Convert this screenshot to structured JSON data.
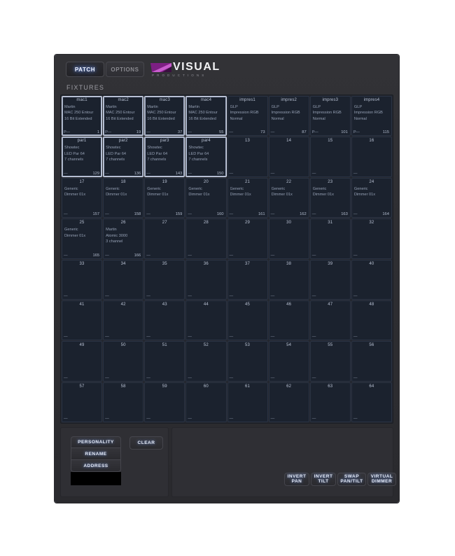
{
  "app": {
    "brand_word": "VISUAL",
    "brand_sub": "PRODUCTIONS",
    "accent_purple": "#a431a8",
    "accent_glow": "#7ea6ff",
    "panel_bg": "#2e2e32",
    "grid_bg": "#23262e",
    "cell_bg": "#1b222e"
  },
  "tabs": [
    {
      "id": "patch",
      "label": "PATCH",
      "active": true
    },
    {
      "id": "options",
      "label": "OPTIONS",
      "active": false
    }
  ],
  "section": {
    "fixtures_label": "FIXTURES"
  },
  "grid": {
    "columns": 8,
    "rows": 8,
    "total": 64,
    "cells": [
      {
        "index": 1,
        "name": "mac1",
        "manufacturer": "Martin",
        "model": "MAC 250 Entour",
        "mode": "16 Bit Extended",
        "prefix": "P—",
        "address": "1",
        "selected": true
      },
      {
        "index": 2,
        "name": "mac2",
        "manufacturer": "Martin",
        "model": "MAC 250 Entour",
        "mode": "16 Bit Extended",
        "prefix": "P—",
        "address": "19",
        "selected": true
      },
      {
        "index": 3,
        "name": "mac3",
        "manufacturer": "Martin",
        "model": "MAC 250 Entour",
        "mode": "16 Bit Extended",
        "prefix": "—",
        "address": "37",
        "selected": true
      },
      {
        "index": 4,
        "name": "mac4",
        "manufacturer": "Martin",
        "model": "MAC 250 Entour",
        "mode": "16 Bit Extended",
        "prefix": "—",
        "address": "55",
        "selected": true
      },
      {
        "index": 5,
        "name": "impres1",
        "manufacturer": "GLP",
        "model": "Impression RGB",
        "mode": "Normal",
        "prefix": "—",
        "address": "73",
        "selected": false
      },
      {
        "index": 6,
        "name": "impres2",
        "manufacturer": "GLP",
        "model": "Impression RGB",
        "mode": "Normal",
        "prefix": "—",
        "address": "87",
        "selected": false
      },
      {
        "index": 7,
        "name": "impres3",
        "manufacturer": "GLP",
        "model": "Impression RGB",
        "mode": "Normal",
        "prefix": "P—",
        "address": "101",
        "selected": false
      },
      {
        "index": 8,
        "name": "impres4",
        "manufacturer": "GLP",
        "model": "Impression RGB",
        "mode": "Normal",
        "prefix": "P—",
        "address": "115",
        "selected": false
      },
      {
        "index": 9,
        "name": "par1",
        "manufacturer": "Showtec",
        "model": "LED Par 64",
        "mode": "7 channels",
        "prefix": "—",
        "address": "129",
        "selected": true
      },
      {
        "index": 10,
        "name": "par2",
        "manufacturer": "Showtec",
        "model": "LED Par 64",
        "mode": "7 channels",
        "prefix": "—",
        "address": "136",
        "selected": true
      },
      {
        "index": 11,
        "name": "par3",
        "manufacturer": "Showtec",
        "model": "LED Par 64",
        "mode": "7 channels",
        "prefix": "—",
        "address": "143",
        "selected": true
      },
      {
        "index": 12,
        "name": "par4",
        "manufacturer": "Showtec",
        "model": "LED Par 64",
        "mode": "7 channels",
        "prefix": "—",
        "address": "150",
        "selected": true
      },
      {
        "index": 13,
        "name": "13",
        "manufacturer": "",
        "model": "",
        "mode": "",
        "prefix": "—",
        "address": "",
        "selected": false
      },
      {
        "index": 14,
        "name": "14",
        "manufacturer": "",
        "model": "",
        "mode": "",
        "prefix": "—",
        "address": "",
        "selected": false
      },
      {
        "index": 15,
        "name": "15",
        "manufacturer": "",
        "model": "",
        "mode": "",
        "prefix": "—",
        "address": "",
        "selected": false
      },
      {
        "index": 16,
        "name": "16",
        "manufacturer": "",
        "model": "",
        "mode": "",
        "prefix": "—",
        "address": "",
        "selected": false
      },
      {
        "index": 17,
        "name": "17",
        "manufacturer": "Generic",
        "model": "Dimmer 01x",
        "mode": "",
        "prefix": "—",
        "address": "157",
        "selected": false
      },
      {
        "index": 18,
        "name": "18",
        "manufacturer": "Generic",
        "model": "Dimmer 01x",
        "mode": "",
        "prefix": "—",
        "address": "158",
        "selected": false
      },
      {
        "index": 19,
        "name": "19",
        "manufacturer": "Generic",
        "model": "Dimmer 01x",
        "mode": "",
        "prefix": "—",
        "address": "159",
        "selected": false
      },
      {
        "index": 20,
        "name": "20",
        "manufacturer": "Generic",
        "model": "Dimmer 01x",
        "mode": "",
        "prefix": "—",
        "address": "160",
        "selected": false
      },
      {
        "index": 21,
        "name": "21",
        "manufacturer": "Generic",
        "model": "Dimmer 01x",
        "mode": "",
        "prefix": "—",
        "address": "161",
        "selected": false
      },
      {
        "index": 22,
        "name": "22",
        "manufacturer": "Generic",
        "model": "Dimmer 01x",
        "mode": "",
        "prefix": "—",
        "address": "162",
        "selected": false
      },
      {
        "index": 23,
        "name": "23",
        "manufacturer": "Generic",
        "model": "Dimmer 01x",
        "mode": "",
        "prefix": "—",
        "address": "163",
        "selected": false
      },
      {
        "index": 24,
        "name": "24",
        "manufacturer": "Generic",
        "model": "Dimmer 01x",
        "mode": "",
        "prefix": "—",
        "address": "164",
        "selected": false
      },
      {
        "index": 25,
        "name": "25",
        "manufacturer": "Generic",
        "model": "Dimmer 01x",
        "mode": "",
        "prefix": "—",
        "address": "165",
        "selected": false
      },
      {
        "index": 26,
        "name": "26",
        "manufacturer": "Martin",
        "model": "Atomic 3000",
        "mode": "3 channel",
        "prefix": "—",
        "address": "166",
        "selected": false
      },
      {
        "index": 27,
        "name": "27",
        "manufacturer": "",
        "model": "",
        "mode": "",
        "prefix": "—",
        "address": "",
        "selected": false
      },
      {
        "index": 28,
        "name": "28",
        "manufacturer": "",
        "model": "",
        "mode": "",
        "prefix": "—",
        "address": "",
        "selected": false
      },
      {
        "index": 29,
        "name": "29",
        "manufacturer": "",
        "model": "",
        "mode": "",
        "prefix": "—",
        "address": "",
        "selected": false
      },
      {
        "index": 30,
        "name": "30",
        "manufacturer": "",
        "model": "",
        "mode": "",
        "prefix": "—",
        "address": "",
        "selected": false
      },
      {
        "index": 31,
        "name": "31",
        "manufacturer": "",
        "model": "",
        "mode": "",
        "prefix": "—",
        "address": "",
        "selected": false
      },
      {
        "index": 32,
        "name": "32",
        "manufacturer": "",
        "model": "",
        "mode": "",
        "prefix": "—",
        "address": "",
        "selected": false
      },
      {
        "index": 33,
        "name": "33",
        "manufacturer": "",
        "model": "",
        "mode": "",
        "prefix": "—",
        "address": "",
        "selected": false
      },
      {
        "index": 34,
        "name": "34",
        "manufacturer": "",
        "model": "",
        "mode": "",
        "prefix": "—",
        "address": "",
        "selected": false
      },
      {
        "index": 35,
        "name": "35",
        "manufacturer": "",
        "model": "",
        "mode": "",
        "prefix": "—",
        "address": "",
        "selected": false
      },
      {
        "index": 36,
        "name": "36",
        "manufacturer": "",
        "model": "",
        "mode": "",
        "prefix": "—",
        "address": "",
        "selected": false
      },
      {
        "index": 37,
        "name": "37",
        "manufacturer": "",
        "model": "",
        "mode": "",
        "prefix": "—",
        "address": "",
        "selected": false
      },
      {
        "index": 38,
        "name": "38",
        "manufacturer": "",
        "model": "",
        "mode": "",
        "prefix": "—",
        "address": "",
        "selected": false
      },
      {
        "index": 39,
        "name": "39",
        "manufacturer": "",
        "model": "",
        "mode": "",
        "prefix": "—",
        "address": "",
        "selected": false
      },
      {
        "index": 40,
        "name": "40",
        "manufacturer": "",
        "model": "",
        "mode": "",
        "prefix": "—",
        "address": "",
        "selected": false
      },
      {
        "index": 41,
        "name": "41",
        "manufacturer": "",
        "model": "",
        "mode": "",
        "prefix": "—",
        "address": "",
        "selected": false
      },
      {
        "index": 42,
        "name": "42",
        "manufacturer": "",
        "model": "",
        "mode": "",
        "prefix": "—",
        "address": "",
        "selected": false
      },
      {
        "index": 43,
        "name": "43",
        "manufacturer": "",
        "model": "",
        "mode": "",
        "prefix": "—",
        "address": "",
        "selected": false
      },
      {
        "index": 44,
        "name": "44",
        "manufacturer": "",
        "model": "",
        "mode": "",
        "prefix": "—",
        "address": "",
        "selected": false
      },
      {
        "index": 45,
        "name": "45",
        "manufacturer": "",
        "model": "",
        "mode": "",
        "prefix": "—",
        "address": "",
        "selected": false
      },
      {
        "index": 46,
        "name": "46",
        "manufacturer": "",
        "model": "",
        "mode": "",
        "prefix": "—",
        "address": "",
        "selected": false
      },
      {
        "index": 47,
        "name": "47",
        "manufacturer": "",
        "model": "",
        "mode": "",
        "prefix": "—",
        "address": "",
        "selected": false
      },
      {
        "index": 48,
        "name": "48",
        "manufacturer": "",
        "model": "",
        "mode": "",
        "prefix": "—",
        "address": "",
        "selected": false
      },
      {
        "index": 49,
        "name": "49",
        "manufacturer": "",
        "model": "",
        "mode": "",
        "prefix": "—",
        "address": "",
        "selected": false
      },
      {
        "index": 50,
        "name": "50",
        "manufacturer": "",
        "model": "",
        "mode": "",
        "prefix": "—",
        "address": "",
        "selected": false
      },
      {
        "index": 51,
        "name": "51",
        "manufacturer": "",
        "model": "",
        "mode": "",
        "prefix": "—",
        "address": "",
        "selected": false
      },
      {
        "index": 52,
        "name": "52",
        "manufacturer": "",
        "model": "",
        "mode": "",
        "prefix": "—",
        "address": "",
        "selected": false
      },
      {
        "index": 53,
        "name": "53",
        "manufacturer": "",
        "model": "",
        "mode": "",
        "prefix": "—",
        "address": "",
        "selected": false
      },
      {
        "index": 54,
        "name": "54",
        "manufacturer": "",
        "model": "",
        "mode": "",
        "prefix": "—",
        "address": "",
        "selected": false
      },
      {
        "index": 55,
        "name": "55",
        "manufacturer": "",
        "model": "",
        "mode": "",
        "prefix": "—",
        "address": "",
        "selected": false
      },
      {
        "index": 56,
        "name": "56",
        "manufacturer": "",
        "model": "",
        "mode": "",
        "prefix": "—",
        "address": "",
        "selected": false
      },
      {
        "index": 57,
        "name": "57",
        "manufacturer": "",
        "model": "",
        "mode": "",
        "prefix": "—",
        "address": "",
        "selected": false
      },
      {
        "index": 58,
        "name": "58",
        "manufacturer": "",
        "model": "",
        "mode": "",
        "prefix": "—",
        "address": "",
        "selected": false
      },
      {
        "index": 59,
        "name": "59",
        "manufacturer": "",
        "model": "",
        "mode": "",
        "prefix": "—",
        "address": "",
        "selected": false
      },
      {
        "index": 60,
        "name": "60",
        "manufacturer": "",
        "model": "",
        "mode": "",
        "prefix": "—",
        "address": "",
        "selected": false
      },
      {
        "index": 61,
        "name": "61",
        "manufacturer": "",
        "model": "",
        "mode": "",
        "prefix": "—",
        "address": "",
        "selected": false
      },
      {
        "index": 62,
        "name": "62",
        "manufacturer": "",
        "model": "",
        "mode": "",
        "prefix": "—",
        "address": "",
        "selected": false
      },
      {
        "index": 63,
        "name": "63",
        "manufacturer": "",
        "model": "",
        "mode": "",
        "prefix": "—",
        "address": "",
        "selected": false
      },
      {
        "index": 64,
        "name": "64",
        "manufacturer": "",
        "model": "",
        "mode": "",
        "prefix": "—",
        "address": "",
        "selected": false
      }
    ]
  },
  "controls": {
    "personality": "PERSONALITY",
    "rename": "RENAME",
    "address": "ADDRESS",
    "clear": "CLEAR",
    "invert_pan_l1": "INVERT",
    "invert_pan_l2": "PAN",
    "invert_tilt_l1": "INVERT",
    "invert_tilt_l2": "TILT",
    "swap_l1": "SWAP",
    "swap_l2": "PAN/TILT",
    "virtual_dimmer_l1": "VIRTUAL",
    "virtual_dimmer_l2": "DIMMER"
  }
}
